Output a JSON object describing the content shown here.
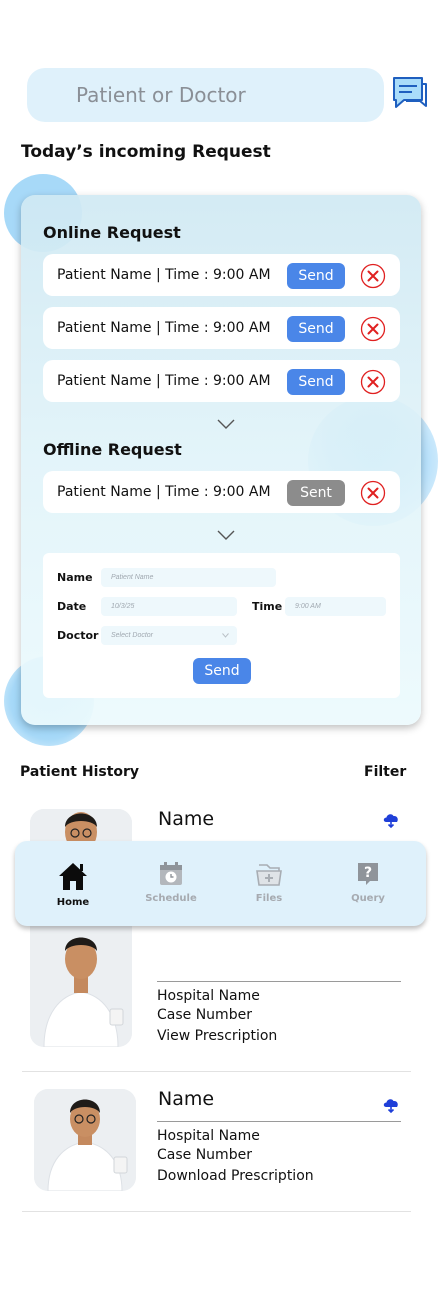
{
  "search": {
    "placeholder": "Patient or Doctor"
  },
  "incoming_title": "Today’s incoming Request",
  "online": {
    "title": "Online Request",
    "requests": [
      {
        "text": "Patient Name | Time : 9:00 AM",
        "button": "Send"
      },
      {
        "text": "Patient Name | Time : 9:00 AM",
        "button": "Send"
      },
      {
        "text": "Patient Name | Time : 9:00 AM",
        "button": "Send"
      }
    ]
  },
  "offline": {
    "title": "Offline Request",
    "requests": [
      {
        "text": "Patient Name | Time : 9:00 AM",
        "button": "Sent"
      }
    ]
  },
  "form": {
    "name_label": "Name",
    "name_placeholder": "Patient Name",
    "date_label": "Date",
    "date_placeholder": "10/3/25",
    "time_label": "Time",
    "time_placeholder": "9:00 AM",
    "doctor_label": "Doctor",
    "doctor_placeholder": "Select Doctor",
    "send_label": "Send"
  },
  "history": {
    "title": "Patient History",
    "filter": "Filter",
    "records": [
      {
        "name": "Name",
        "hospital": "Hospital Name",
        "case": "Case Number",
        "action": "View Prescription"
      },
      {
        "name": "Name",
        "hospital": "Hospital Name",
        "case": "Case Number",
        "action": "Download Prescription"
      }
    ]
  },
  "nav": {
    "items": [
      {
        "label": "Home",
        "icon": "home-icon",
        "active": true
      },
      {
        "label": "Schedule",
        "icon": "calendar-icon",
        "active": false
      },
      {
        "label": "Files",
        "icon": "files-icon",
        "active": false
      },
      {
        "label": "Query",
        "icon": "query-icon",
        "active": false
      }
    ]
  },
  "colors": {
    "accent": "#4a86e8",
    "panel": "#dff1fb",
    "sent": "#8c8c8c",
    "reject": "#e02020"
  }
}
